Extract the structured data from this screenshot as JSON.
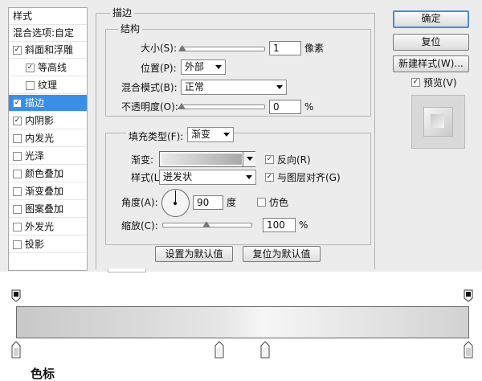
{
  "sidebar": {
    "header": "样式",
    "blend_options": "混合选项:自定",
    "items": [
      {
        "label": "斜面和浮雕",
        "checked": true,
        "indent": false,
        "selected": false
      },
      {
        "label": "等高线",
        "checked": true,
        "indent": true,
        "selected": false
      },
      {
        "label": "纹理",
        "checked": false,
        "indent": true,
        "selected": false
      },
      {
        "label": "描边",
        "checked": true,
        "indent": false,
        "selected": true
      },
      {
        "label": "内阴影",
        "checked": true,
        "indent": false,
        "selected": false
      },
      {
        "label": "内发光",
        "checked": false,
        "indent": false,
        "selected": false
      },
      {
        "label": "光泽",
        "checked": false,
        "indent": false,
        "selected": false
      },
      {
        "label": "颜色叠加",
        "checked": false,
        "indent": false,
        "selected": false
      },
      {
        "label": "渐变叠加",
        "checked": false,
        "indent": false,
        "selected": false
      },
      {
        "label": "图案叠加",
        "checked": false,
        "indent": false,
        "selected": false
      },
      {
        "label": "外发光",
        "checked": false,
        "indent": false,
        "selected": false
      },
      {
        "label": "投影",
        "checked": false,
        "indent": false,
        "selected": false
      }
    ]
  },
  "stroke": {
    "title": "描边",
    "structure_title": "结构",
    "size_label": "大小(S):",
    "size_value": "1",
    "size_unit": "像素",
    "size_slider_fraction": 0.01,
    "position_label": "位置(P):",
    "position_value": "外部",
    "blend_label": "混合模式(B):",
    "blend_value": "正常",
    "opacity_label": "不透明度(O):",
    "opacity_value": "0",
    "opacity_unit": "%",
    "opacity_slider_fraction": 0.0,
    "fill_type_label": "填充类型(F):",
    "fill_type_value": "渐变",
    "gradient_label": "渐变:",
    "reverse_label": "反向(R)",
    "reverse_checked": true,
    "style_label": "样式(L):",
    "style_value": "迸发状",
    "align_label": "与图层对齐(G)",
    "align_checked": true,
    "angle_label": "角度(A):",
    "angle_value": "90",
    "angle_unit": "度",
    "dither_label": "仿色",
    "dither_checked": false,
    "scale_label": "缩放(C):",
    "scale_value": "100",
    "scale_unit": "%",
    "scale_slider_fraction": 0.5,
    "set_default_button": "设置为默认值",
    "reset_default_button": "复位为默认值"
  },
  "right_panel": {
    "ok_button": "确定",
    "reset_button": "复位",
    "new_style_button": "新建样式(W)...",
    "preview_label": "预览(V)",
    "preview_checked": true
  },
  "gradient_editor": {
    "bottom_label": "色标"
  }
}
